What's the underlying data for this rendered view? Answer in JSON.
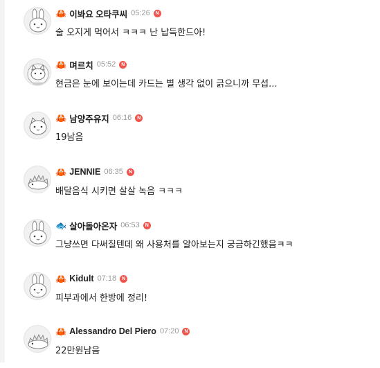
{
  "comments": [
    {
      "badge": "🦀",
      "nickname": "이봐요 오타쿠씨",
      "time": "05:26",
      "new": "N",
      "text": "술 오지게 먹어서 ㅋㅋㅋ 난 납득한드아!",
      "avatar": "rabbit"
    },
    {
      "badge": "🦀",
      "nickname": "며르치",
      "time": "05:52",
      "new": "N",
      "text": "현금은 눈에 보이는데 카드는 별 생각 없이 긁으니까 무섭...",
      "avatar": "cat-globe"
    },
    {
      "badge": "🦀",
      "nickname": "남양주유지",
      "time": "06:16",
      "new": "N",
      "text": "19남음",
      "avatar": "cat"
    },
    {
      "badge": "🦀",
      "nickname": "JENNIE",
      "time": "06:35",
      "new": "N",
      "text": "배달음식 시키면 살살 녹음 ㅋㅋㅋ",
      "avatar": "hedgehog"
    },
    {
      "badge": "🐟",
      "nickname": "살아돌아온자",
      "time": "06:53",
      "new": "N",
      "text": "그냥쓰면 다써질텐데 왜 사용처를 알아보는지 궁금하긴했음ㅋㅋ",
      "avatar": "rabbit"
    },
    {
      "badge": "🦀",
      "nickname": "Kidult",
      "time": "07:18",
      "new": "N",
      "text": "피부과에서 한방에 정리!",
      "avatar": "rabbit"
    },
    {
      "badge": "🦀",
      "nickname": "Alessandro Del Piero",
      "time": "07:20",
      "new": "N",
      "text": "22만원남음",
      "avatar": "hedgehog"
    }
  ]
}
